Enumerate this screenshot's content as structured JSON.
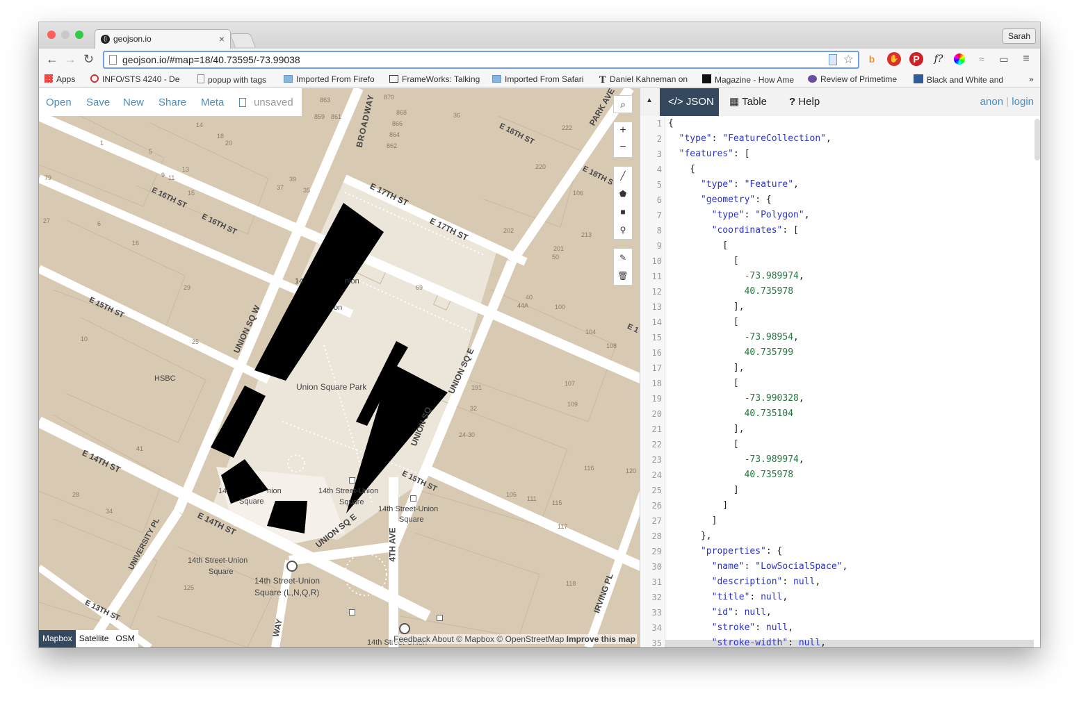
{
  "browser": {
    "tab_title": "geojson.io",
    "profile_name": "Sarah",
    "url": "geojson.io/#map=18/40.73595/-73.99038",
    "bookmarks": [
      {
        "label": "Apps",
        "icon": "apps-grid-icon"
      },
      {
        "label": "INFO/STS 4240 - De",
        "icon": "shield-icon"
      },
      {
        "label": "popup with tags",
        "icon": "page-icon"
      },
      {
        "label": "Imported From Firefo",
        "icon": "folder-icon"
      },
      {
        "label": "FrameWorks: Talking",
        "icon": "fw-icon"
      },
      {
        "label": "Imported From Safari",
        "icon": "folder-icon"
      },
      {
        "label": "Daniel Kahneman on",
        "icon": "nyt-icon"
      },
      {
        "label": "Magazine - How Ame",
        "icon": "atlantic-icon"
      },
      {
        "label": "Review of Primetime",
        "icon": "rpg-icon"
      },
      {
        "label": "Black and White and",
        "icon": "mmfa-icon"
      }
    ],
    "bookmarks_overflow": "»"
  },
  "map": {
    "menu": {
      "open": "Open",
      "save": "Save",
      "new": "New",
      "share": "Share",
      "meta": "Meta",
      "status": "unsaved"
    },
    "labels": {
      "broadway": "BROADWAY",
      "broadway_bottom": "WAY",
      "park_ave": "PARK AVE",
      "e18th_a": "E 18TH ST",
      "e18th_b": "E 18TH S",
      "e17th_a": "E 17TH ST",
      "e17th_b": "E 17TH ST",
      "e16th_a": "E 16TH ST",
      "e16th_b": "E 16TH ST",
      "e15th_a": "E 15TH ST",
      "e15th_b": "E 15TH ST",
      "e15th_c": "E 1",
      "e14th_a": "E 14TH ST",
      "e14th_b": "E 14TH ST",
      "e13th": "E 13TH ST",
      "union_sq_w": "UNION SQ W",
      "union_sq_e": "UNION SQ E",
      "union_sq_e2": "UNION SQ E",
      "union_sq_e3": "UNION SQ",
      "university_pl": "UNIVERSITY PL",
      "fourth_ave": "4TH AVE",
      "irving_pl": "IRVING PL",
      "park": "Union Square Park",
      "hsbc": "HSBC",
      "station1a": "14th Street-Union",
      "station1b": "Square",
      "station2a": "14th Street-Union",
      "station2b": "Square",
      "station3a": "14th Street-Union",
      "station3b": "Square",
      "station4a": "14th Street-Union",
      "station4b": "Square (L,N,Q,R)",
      "station5": "14th Street-Union",
      "label14a": "14",
      "label14b": "nion",
      "label14c": "Square",
      "poi1": "14",
      "poi2": "nion",
      "poi3": "on",
      "num_863": "863",
      "num_861": "861",
      "num_859": "859",
      "num_870": "870",
      "num_868": "868",
      "num_866": "866",
      "num_864": "864",
      "num_862": "862",
      "num_36": "36",
      "num_220": "220",
      "num_202": "202",
      "num_222": "222",
      "num_106": "106",
      "num_213": "213",
      "num_201": "201",
      "num_50": "50",
      "num_100": "100",
      "num_104": "104",
      "num_108": "108",
      "num_107": "107",
      "num_109": "109",
      "num_191": "191",
      "num_32": "32",
      "num_2430": "24-30",
      "num_116": "116",
      "num_120": "120",
      "num_105": "105",
      "num_111": "111",
      "num_115": "115",
      "num_117": "117",
      "num_118": "118",
      "num_125": "125",
      "num_28": "28",
      "num_34": "34",
      "num_41": "41",
      "num_10": "10",
      "num_25": "25",
      "num_29": "29",
      "num_16": "16",
      "num_6": "6",
      "num_5": "5",
      "num_1": "1",
      "num_9": "9",
      "num_11": "11",
      "num_13": "13",
      "num_15": "15",
      "num_37": "37",
      "num_39": "39",
      "num_14": "14",
      "num_18": "18",
      "num_20": "20",
      "num_79": "79",
      "num_27": "27",
      "num_69": "69",
      "num_44a": "44A",
      "num_40": "40",
      "num_35": "35"
    },
    "layers": [
      "Mapbox",
      "Satellite",
      "OSM"
    ],
    "attribution_prefix": "Feedback  About  © Mapbox © OpenStreetMap ",
    "attribution_link": "Improve this map"
  },
  "panel": {
    "tabs": [
      {
        "label": "JSON",
        "icon": "code-icon"
      },
      {
        "label": "Table",
        "icon": "table-icon"
      },
      {
        "label": "Help",
        "icon": "help-icon"
      }
    ],
    "auth_anon": "anon",
    "auth_sep": "|",
    "auth_login": "login",
    "line_numbers": [
      "1",
      "2",
      "3",
      "4",
      "5",
      "6",
      "7",
      "8",
      "9",
      "10",
      "11",
      "12",
      "13",
      "14",
      "15",
      "16",
      "17",
      "18",
      "19",
      "20",
      "21",
      "22",
      "23",
      "24",
      "25",
      "26",
      "27",
      "28",
      "29",
      "30",
      "31",
      "32",
      "33",
      "34",
      "35"
    ],
    "code_lines": [
      "{",
      "  \"type\": \"FeatureCollection\",",
      "  \"features\": [",
      "    {",
      "      \"type\": \"Feature\",",
      "      \"geometry\": {",
      "        \"type\": \"Polygon\",",
      "        \"coordinates\": [",
      "          [",
      "            [",
      "              -73.989974,",
      "              40.735978",
      "            ],",
      "            [",
      "              -73.98954,",
      "              40.735799",
      "            ],",
      "            [",
      "              -73.990328,",
      "              40.735104",
      "            ],",
      "            [",
      "              -73.989974,",
      "              40.735978",
      "            ]",
      "          ]",
      "        ]",
      "      },",
      "      \"properties\": {",
      "        \"name\": \"LowSocialSpace\",",
      "        \"description\": null,",
      "        \"title\": null,",
      "        \"id\": null,",
      "        \"stroke\": null,",
      "        \"stroke-width\": null,"
    ]
  }
}
